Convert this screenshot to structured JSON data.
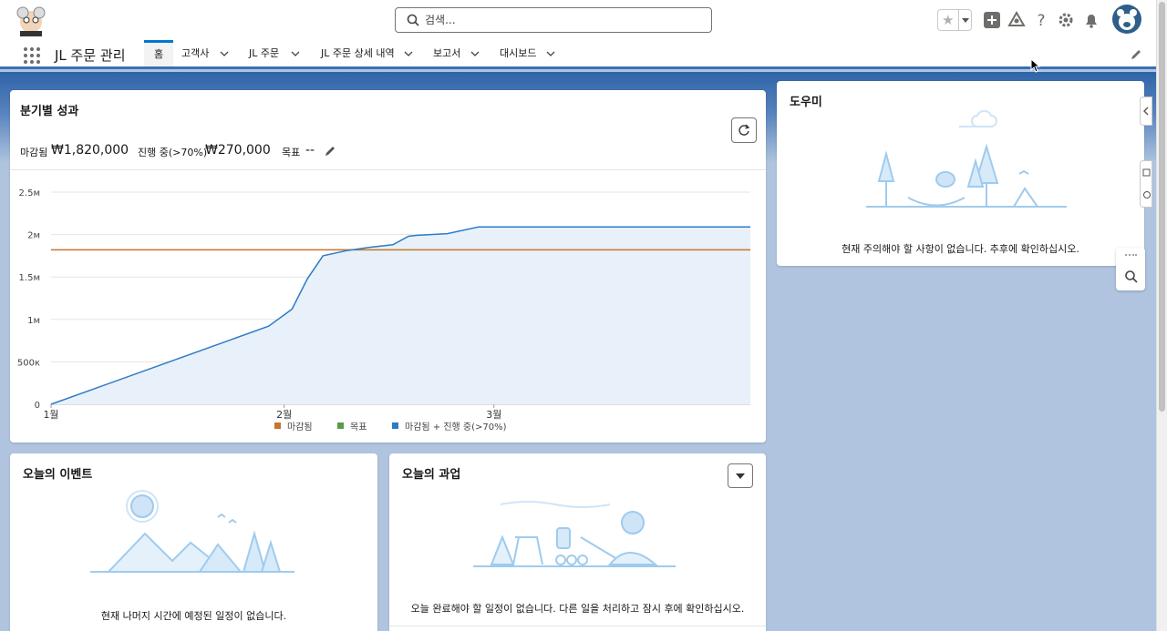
{
  "search": {
    "placeholder": "검색..."
  },
  "nav": {
    "app_name": "JL 주문 관리",
    "tabs": [
      {
        "label": "홈",
        "active": true
      },
      {
        "label": "고객사"
      },
      {
        "label": "JL 주문"
      },
      {
        "label": "JL 주문 상세 내역"
      },
      {
        "label": "보고서"
      },
      {
        "label": "대시보드"
      }
    ]
  },
  "quarterly": {
    "title": "분기별 성과",
    "closed_label": "마감됨",
    "closed_value": "₩1,820,000",
    "open_label": "진행 중(>70%)",
    "open_value": "₩270,000",
    "goal_label": "목표",
    "goal_value": "--"
  },
  "chart_data": {
    "type": "line",
    "x_tick_labels": [
      "1월",
      "2월",
      "3월"
    ],
    "y_tick_labels": [
      "0",
      "500к",
      "1м",
      "1.5м",
      "2м",
      "2.5м"
    ],
    "ylim": [
      0,
      2500000
    ],
    "xlim": [
      0,
      90
    ],
    "legend": [
      "마감됨",
      "목표",
      "마감됨 + 진행 중(>70%)"
    ],
    "legend_placement": "bottom",
    "colors": {
      "closed": "#c9732b",
      "goal": "#5c9a4a",
      "closed_open": "#2e7bc6"
    },
    "series": [
      {
        "name": "마감됨",
        "x": [
          0,
          90
        ],
        "values": [
          1820000,
          1820000
        ]
      },
      {
        "name": "마감됨 + 진행 중(>70%)",
        "x": [
          0,
          28,
          31,
          33,
          35,
          38,
          41,
          44,
          46,
          47,
          51,
          55,
          59,
          90
        ],
        "values": [
          0,
          920000,
          1120000,
          1480000,
          1750000,
          1810000,
          1850000,
          1880000,
          1980000,
          1990000,
          2010000,
          2090000,
          2090000,
          2090000
        ]
      }
    ]
  },
  "helper": {
    "title": "도우미",
    "message": "현재 주의해야 할 사항이 없습니다. 추후에 확인하십시오."
  },
  "events": {
    "title": "오늘의 이벤트",
    "message": "현재 나머지 시간에 예정된 일정이 없습니다."
  },
  "tasks": {
    "title": "오늘의 과업",
    "message": "오늘 완료해야 할 일정이 없습니다. 다른 일을 처리하고 잠시 후에 확인하십시오."
  }
}
